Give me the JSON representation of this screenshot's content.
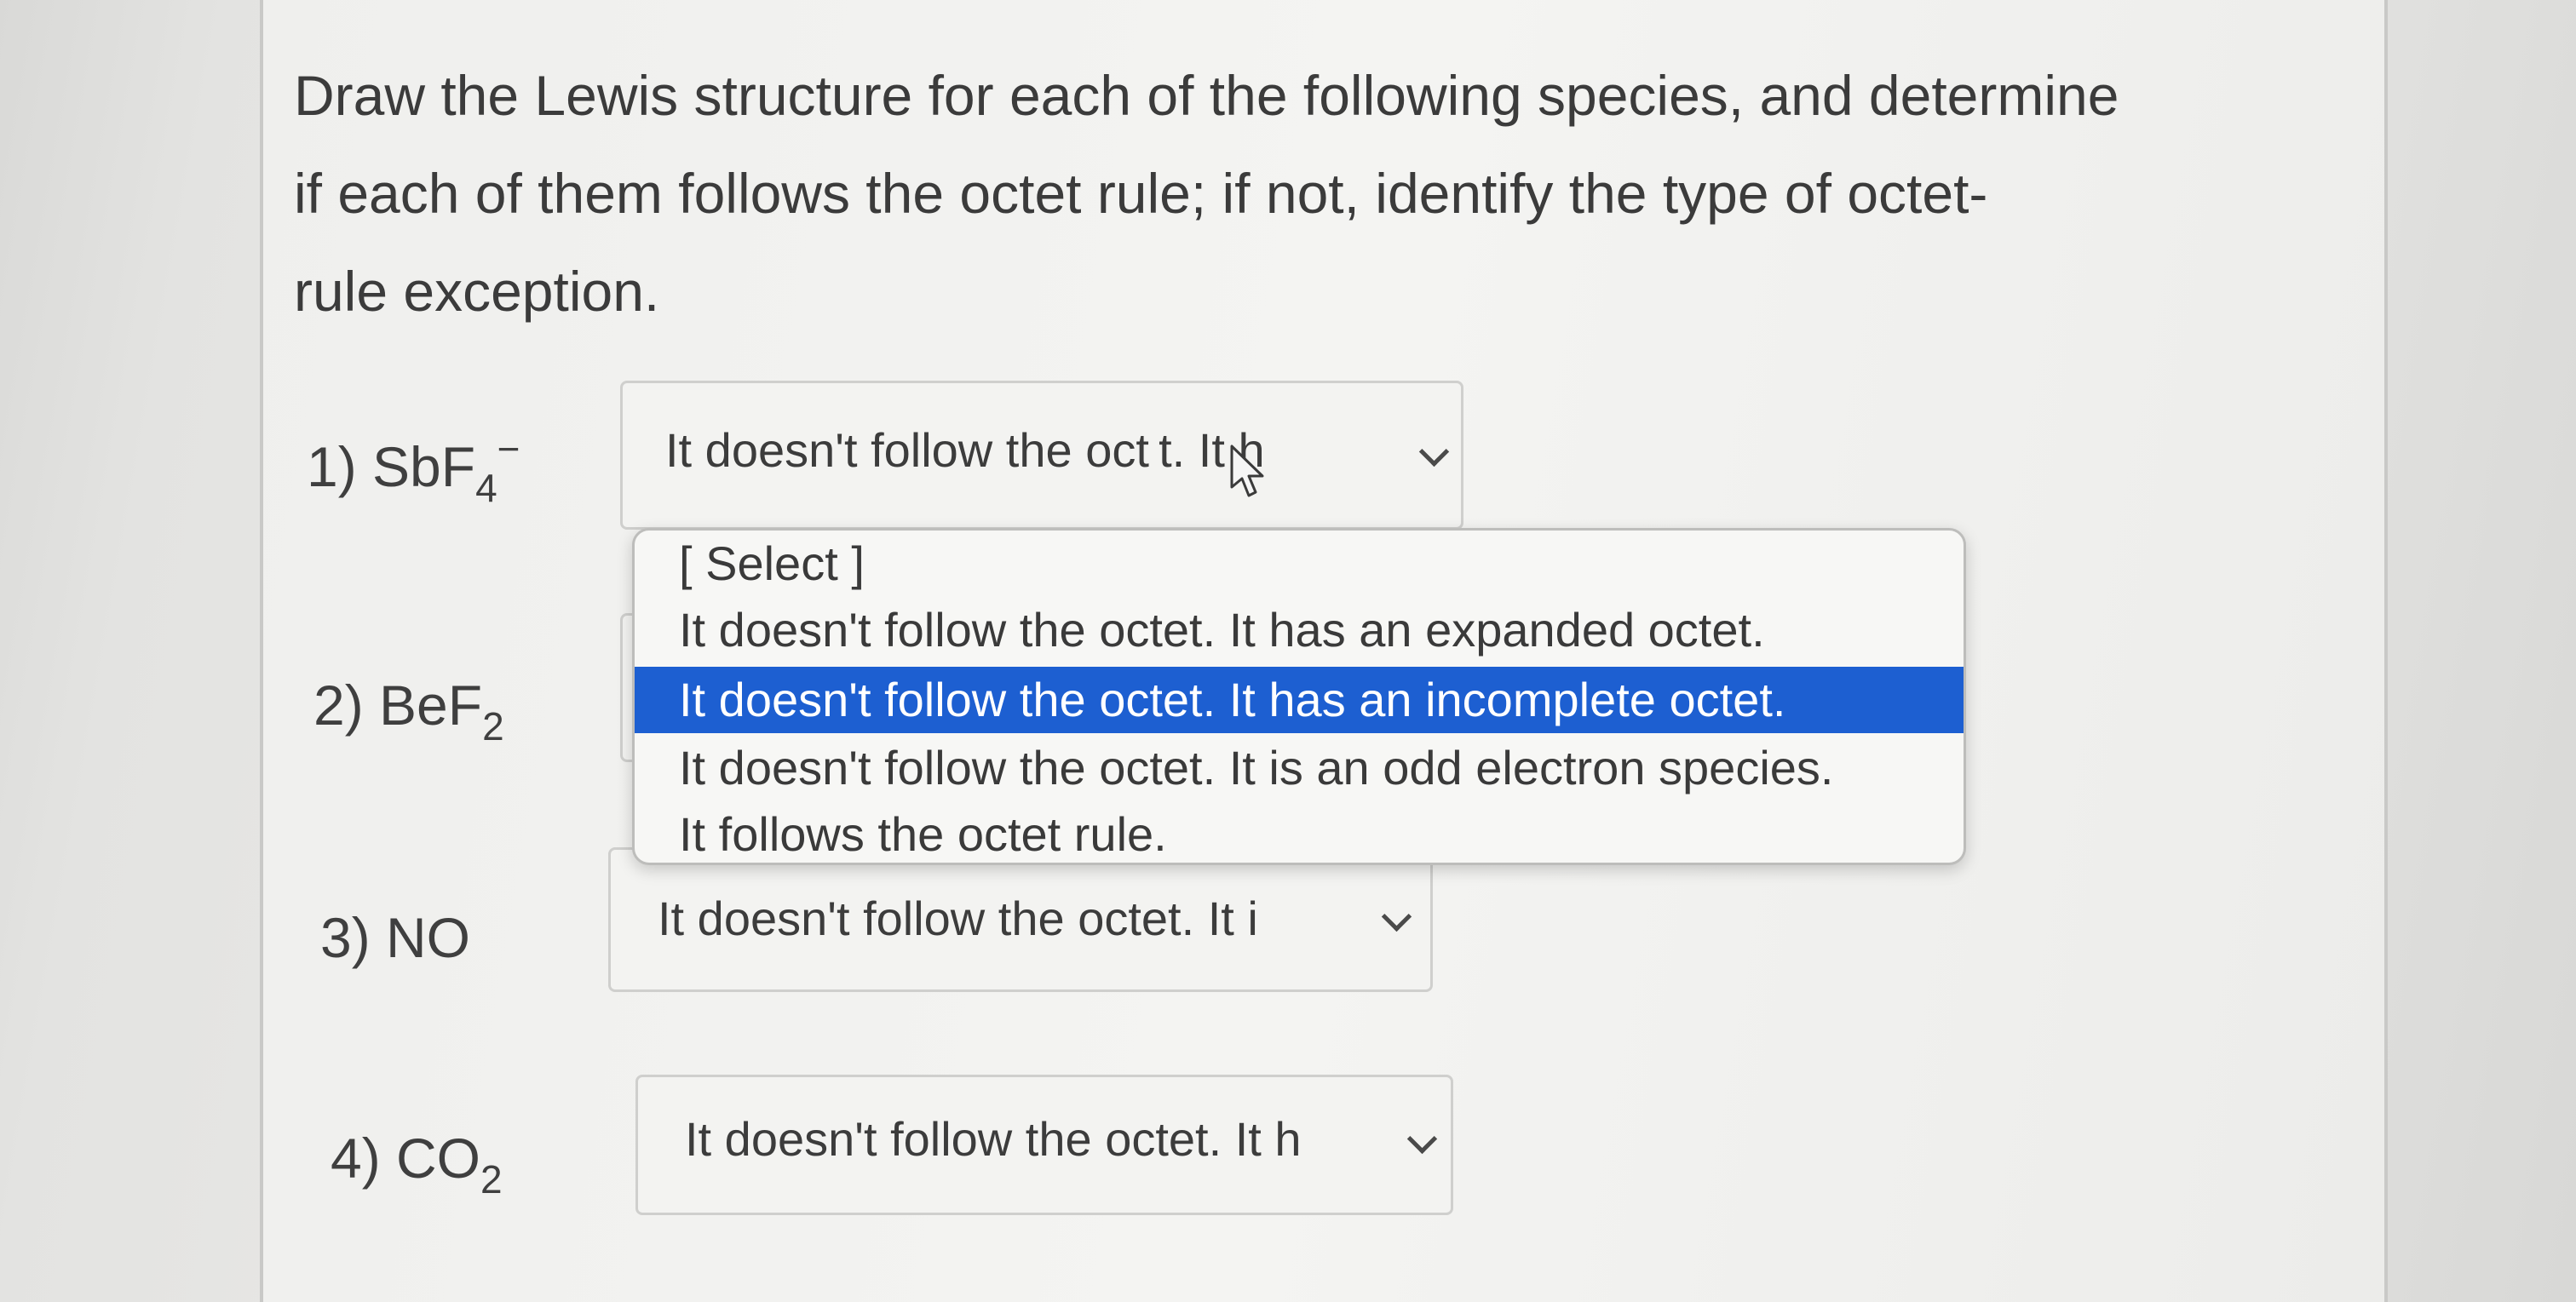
{
  "question": {
    "line1": "Draw the Lewis structure for each of the following species, and determine",
    "line2": "if each of them follows the octet rule; if not, identify the type of octet-",
    "line3": "rule exception."
  },
  "items": [
    {
      "prefix": "1) SbF",
      "sub": "4",
      "sup": "−",
      "selected": "It doesn't follow the oct t. It h"
    },
    {
      "prefix": "2) BeF",
      "sub": "2",
      "sup": "",
      "selected": ""
    },
    {
      "prefix": "3) NO",
      "sub": "",
      "sup": "",
      "selected": "It doesn't follow the octet. It i"
    },
    {
      "prefix": "4) CO",
      "sub": "2",
      "sup": "",
      "selected": "It doesn't follow the octet. It h"
    }
  ],
  "dropdown": {
    "options": [
      "[ Select ]",
      "It doesn't follow the octet. It has an expanded octet.",
      "It doesn't follow the octet. It has an incomplete octet.",
      "It doesn't follow the octet. It is an odd electron species.",
      "It follows the octet rule."
    ],
    "highlighted": "It doesn't follow the octet. It has an incomplete octet."
  },
  "colors": {
    "highlight": "#1d5fd1",
    "text": "#3b3b3b"
  },
  "icons": {
    "chevron": "chevron-down-icon",
    "cursor": "mouse-pointer-icon"
  }
}
